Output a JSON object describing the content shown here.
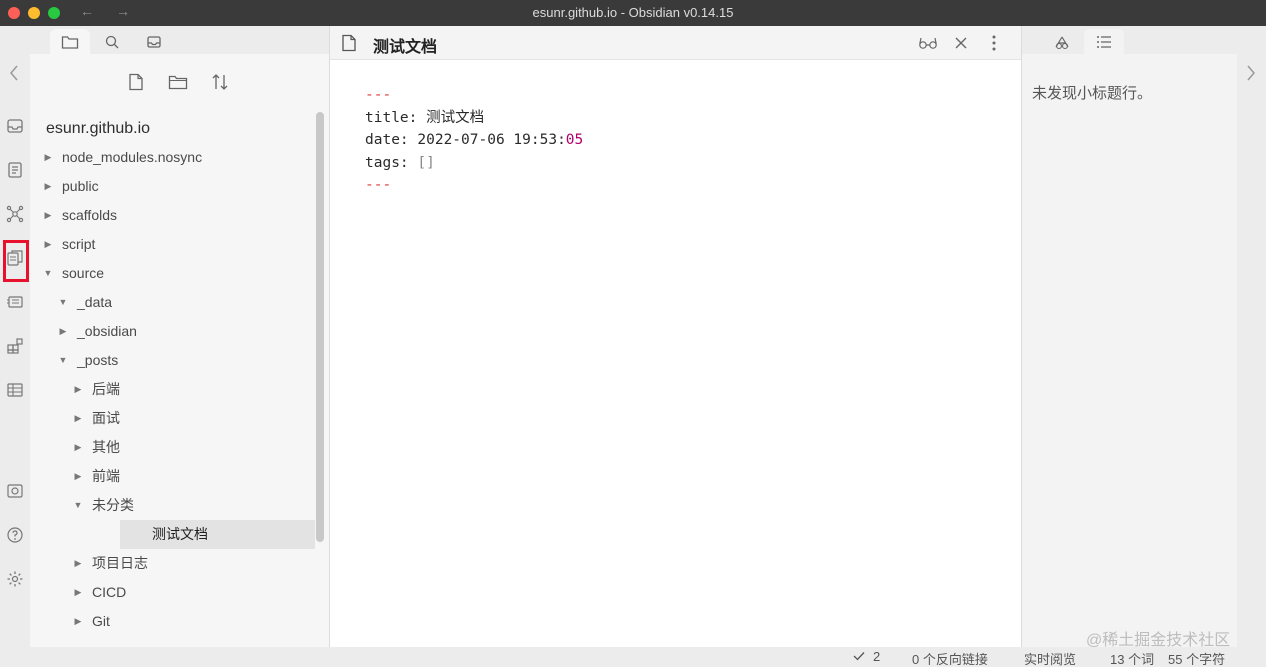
{
  "window": {
    "title": "esunr.github.io - Obsidian v0.14.15",
    "back_arrow": "←",
    "forward_arrow": "→"
  },
  "explorer": {
    "vault_name": "esunr.github.io",
    "tree": [
      {
        "label": "node_modules.nosync",
        "level": 0,
        "expanded": false
      },
      {
        "label": "public",
        "level": 0,
        "expanded": false
      },
      {
        "label": "scaffolds",
        "level": 0,
        "expanded": false
      },
      {
        "label": "script",
        "level": 0,
        "expanded": false
      },
      {
        "label": "source",
        "level": 0,
        "expanded": true
      },
      {
        "label": "_data",
        "level": 1,
        "expanded": true
      },
      {
        "label": "_obsidian",
        "level": 1,
        "expanded": false
      },
      {
        "label": "_posts",
        "level": 1,
        "expanded": true
      },
      {
        "label": "后端",
        "level": 2,
        "expanded": false
      },
      {
        "label": "面试",
        "level": 2,
        "expanded": false
      },
      {
        "label": "其他",
        "level": 2,
        "expanded": false
      },
      {
        "label": "前端",
        "level": 2,
        "expanded": false
      },
      {
        "label": "未分类",
        "level": 2,
        "expanded": true
      },
      {
        "label": "测试文档",
        "level": 3,
        "file": true,
        "selected": true
      },
      {
        "label": "项目日志",
        "level": 2,
        "expanded": false
      },
      {
        "label": "CICD",
        "level": 2,
        "expanded": false
      },
      {
        "label": "Git",
        "level": 2,
        "expanded": false
      }
    ]
  },
  "editor": {
    "title": "测试文档",
    "frontmatter": {
      "delimiter": "---",
      "title_key": "title:",
      "title_value": "测试文档",
      "date_key": "date:",
      "date_value": "2022-07-06 19:53:",
      "date_seconds": "05",
      "tags_key": "tags:",
      "tags_value": "[]"
    }
  },
  "outline": {
    "empty_message": "未发现小标题行。"
  },
  "statusbar": {
    "sync_count": "2",
    "backlinks": "0 个反向链接",
    "mode": "实时阅览",
    "words": "13 个词",
    "chars": "55 个字符"
  },
  "watermark": "@稀土掘金技术社区",
  "colors": {
    "accent_highlight": "#e8112d",
    "frontmatter_dash": "#e0373b",
    "number": "#b0006b"
  }
}
